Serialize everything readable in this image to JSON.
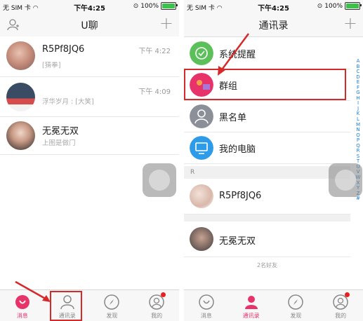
{
  "status_bar": {
    "carrier": "无 SIM 卡",
    "time": "下午4:25",
    "battery": "100%",
    "battery_level": 1.0
  },
  "left_screen": {
    "title": "U聊",
    "plus": "+",
    "chats": [
      {
        "name": "R5Pf8JQ6",
        "time": "下午 4:22",
        "preview": "[猜拳]"
      },
      {
        "name": "",
        "time": "下午 4:09",
        "preview": "浮华岁月 : [大笑]"
      },
      {
        "name": "无冕无双",
        "time": "",
        "preview": "上图是做门"
      }
    ]
  },
  "right_screen": {
    "title": "通讯录",
    "plus": "+",
    "fixed_items": [
      {
        "label": "系统提醒",
        "icon": "shield-check-icon",
        "color": "#5cc05a"
      },
      {
        "label": "群组",
        "icon": "group-icon",
        "color": "#e8336a"
      },
      {
        "label": "黑名单",
        "icon": "person-icon",
        "color": "#8a8f98"
      },
      {
        "label": "我的电脑",
        "icon": "monitor-icon",
        "color": "#2e9be8"
      }
    ],
    "section_letter": "R",
    "contacts": [
      {
        "name": "R5Pf8JQ6"
      },
      {
        "name": "无冕无双"
      }
    ],
    "friend_count": "2名好友",
    "index_letters": [
      "A",
      "B",
      "C",
      "D",
      "E",
      "F",
      "G",
      "H",
      "I",
      "J",
      "K",
      "L",
      "M",
      "N",
      "O",
      "P",
      "Q",
      "R",
      "S",
      "T",
      "U",
      "V",
      "W",
      "X",
      "Y",
      "Z",
      "#"
    ]
  },
  "tabs": [
    {
      "label": "消息",
      "icon": "message-icon"
    },
    {
      "label": "通讯录",
      "icon": "contacts-icon"
    },
    {
      "label": "发现",
      "icon": "compass-icon"
    },
    {
      "label": "我的",
      "icon": "profile-icon"
    }
  ],
  "colors": {
    "accent": "#e8336a",
    "highlight": "#d52a2a",
    "index": "#1a7fd6",
    "badge": "#e8201f"
  }
}
